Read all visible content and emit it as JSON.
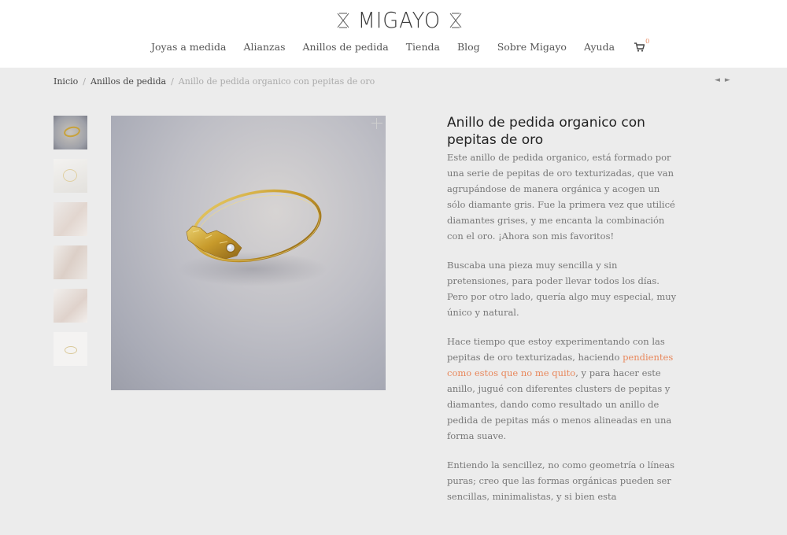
{
  "header": {
    "logo_text": "MIGAYO",
    "nav": [
      "Joyas a medida",
      "Alianzas",
      "Anillos de pedida",
      "Tienda",
      "Blog",
      "Sobre Migayo",
      "Ayuda"
    ],
    "cart_count": "0",
    "cart_icon": "shopping-cart-icon"
  },
  "breadcrumb": {
    "home": "Inicio",
    "category": "Anillos de pedida",
    "current": "Anillo de pedida organico con pepitas de oro",
    "separator": "/"
  },
  "pager": {
    "prev": "◄",
    "next": "►"
  },
  "product": {
    "title": "Anillo de pedida organico con pepitas de oro",
    "p1": "Este anillo de pedida organico, está formado por una serie de pepitas de oro texturizadas, que van agrupándose de manera orgánica y acogen un sólo diamante gris. Fue la primera vez que utilicé diamantes grises, y me encanta la combinación con el oro. ¡Ahora son mis favoritos!",
    "p2": "Buscaba una pieza muy sencilla y sin pretensiones, para poder llevar todos los días. Pero por otro lado, quería algo muy especial, muy único y natural.",
    "p3_before": "Hace tiempo que estoy experimentando con las pepitas de oro texturizadas, haciendo ",
    "p3_link": "pendientes como estos que no me quito",
    "p3_after": ", y para hacer este anillo, jugué con diferentes clusters de pepitas y diamantes, dando como resultado un anillo de pedida de pepitas más o menos alineadas en una forma suave.",
    "p4": "Entiendo la sencillez, no como geometría o líneas puras; creo que las formas orgánicas pueden ser sencillas, minimalistas, y si bien esta"
  },
  "colors": {
    "accent": "#e8875b",
    "background": "#ececec",
    "header": "#ffffff"
  }
}
